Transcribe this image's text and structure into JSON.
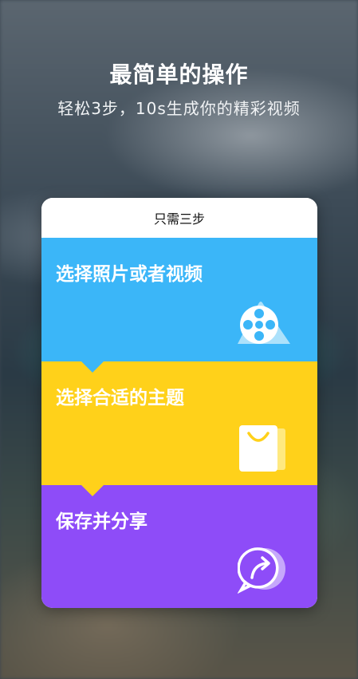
{
  "header": {
    "title": "最简单的操作",
    "subtitle": "轻松3步，10s生成你的精彩视频"
  },
  "card": {
    "header": "只需三步",
    "steps": [
      {
        "label": "选择照片或者视频",
        "color": "#3bb6f8",
        "icon": "film-reel-icon"
      },
      {
        "label": "选择合适的主题",
        "color": "#ffd11a",
        "icon": "shopping-bag-icon"
      },
      {
        "label": "保存并分享",
        "color": "#8e4cf8",
        "icon": "share-arrow-icon"
      }
    ]
  },
  "colors": {
    "step1": "#3bb6f8",
    "step2": "#ffd11a",
    "step3": "#8e4cf8"
  }
}
